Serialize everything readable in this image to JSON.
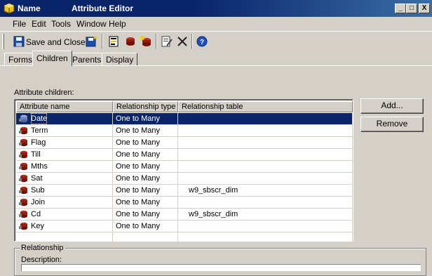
{
  "window": {
    "name_label": "Name",
    "title": "Attribute Editor",
    "minimize": "_",
    "maximize": "□",
    "close": "X"
  },
  "menu": [
    "File",
    "Edit",
    "Tools",
    "Window",
    "Help"
  ],
  "toolbar": {
    "save_close_label": "Save and Close"
  },
  "tabs": [
    "Forms",
    "Children",
    "Parents",
    "Display"
  ],
  "active_tab": "Children",
  "children_label": "Attribute children:",
  "grid": {
    "columns": [
      "Attribute name",
      "Relationship type",
      "Relationship table"
    ],
    "rows": [
      {
        "name": "Date",
        "type": "One to Many",
        "table": "",
        "selected": true
      },
      {
        "name": "Term",
        "type": "One to Many",
        "table": ""
      },
      {
        "name": "Flag",
        "type": "One to Many",
        "table": ""
      },
      {
        "name": "Till",
        "type": "One to Many",
        "table": ""
      },
      {
        "name": "Mths",
        "type": "One to Many",
        "table": ""
      },
      {
        "name": "Sat",
        "type": "One to Many",
        "table": ""
      },
      {
        "name": "Sub",
        "type": "One to Many",
        "table": "w9_sbscr_dim"
      },
      {
        "name": "Join",
        "type": "One to Many",
        "table": ""
      },
      {
        "name": "Cd",
        "type": "One to Many",
        "table": "w9_sbscr_dim"
      },
      {
        "name": "Key",
        "type": "One to Many",
        "table": ""
      }
    ]
  },
  "buttons": {
    "add": "Add...",
    "remove": "Remove"
  },
  "relationship": {
    "group_label": "Relationship",
    "description_label": "Description:"
  }
}
